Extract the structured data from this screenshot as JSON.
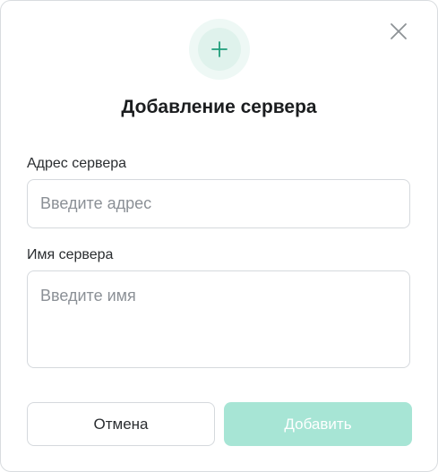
{
  "dialog": {
    "title": "Добавление сервера",
    "icons": {
      "hero": "plus-icon",
      "close": "close-icon"
    },
    "colors": {
      "accent": "#1f9e7a",
      "hero_outer_bg": "#eef8f5",
      "hero_inner_bg": "#dff2ec",
      "primary_disabled_bg": "#a7e5d5"
    }
  },
  "form": {
    "address": {
      "label": "Адрес сервера",
      "placeholder": "Введите адрес",
      "value": ""
    },
    "name": {
      "label": "Имя сервера",
      "placeholder": "Введите имя",
      "value": ""
    }
  },
  "actions": {
    "cancel_label": "Отмена",
    "add_label": "Добавить",
    "add_enabled": false
  }
}
